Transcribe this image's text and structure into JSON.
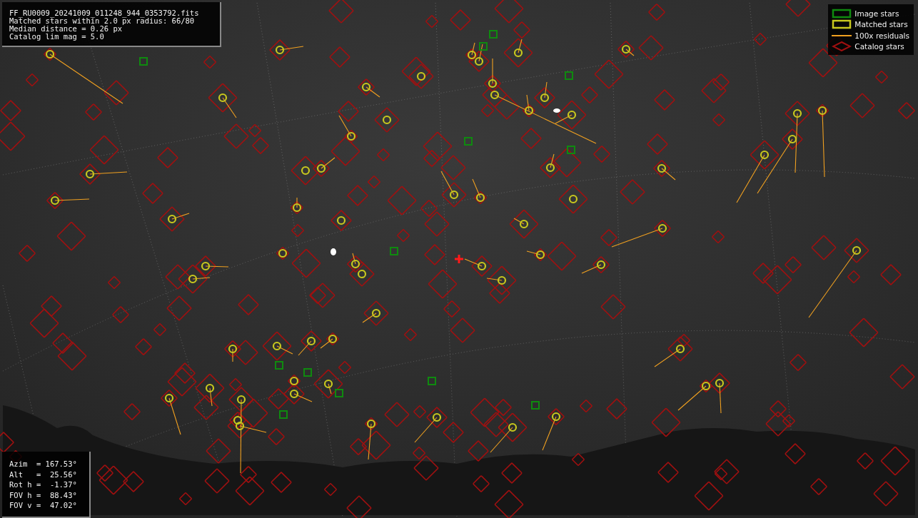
{
  "info_box": {
    "lines": [
      "FF_RU0009_20241009_011248_944_0353792.fits",
      "Matched stars within 2.0 px radius: 66/80",
      "Median distance = 0.26 px",
      "Catalog lim mag = 5.0"
    ]
  },
  "legend": {
    "items": [
      {
        "kind": "image",
        "label": "Image stars",
        "color": "#0f8a0f"
      },
      {
        "kind": "matched",
        "label": "Matched stars",
        "color": "#c8c81e"
      },
      {
        "kind": "residual",
        "label": "100x residuals",
        "color": "#f0a020"
      },
      {
        "kind": "catalog",
        "label": "Catalog stars",
        "color": "#a01010"
      }
    ]
  },
  "pointing_box": {
    "lines": [
      "Azim  = 167.53°",
      "Alt   =  25.56°",
      "Rot h =  -1.37°",
      "FOV h =  88.43°",
      "FOV v =  47.02°"
    ]
  }
}
